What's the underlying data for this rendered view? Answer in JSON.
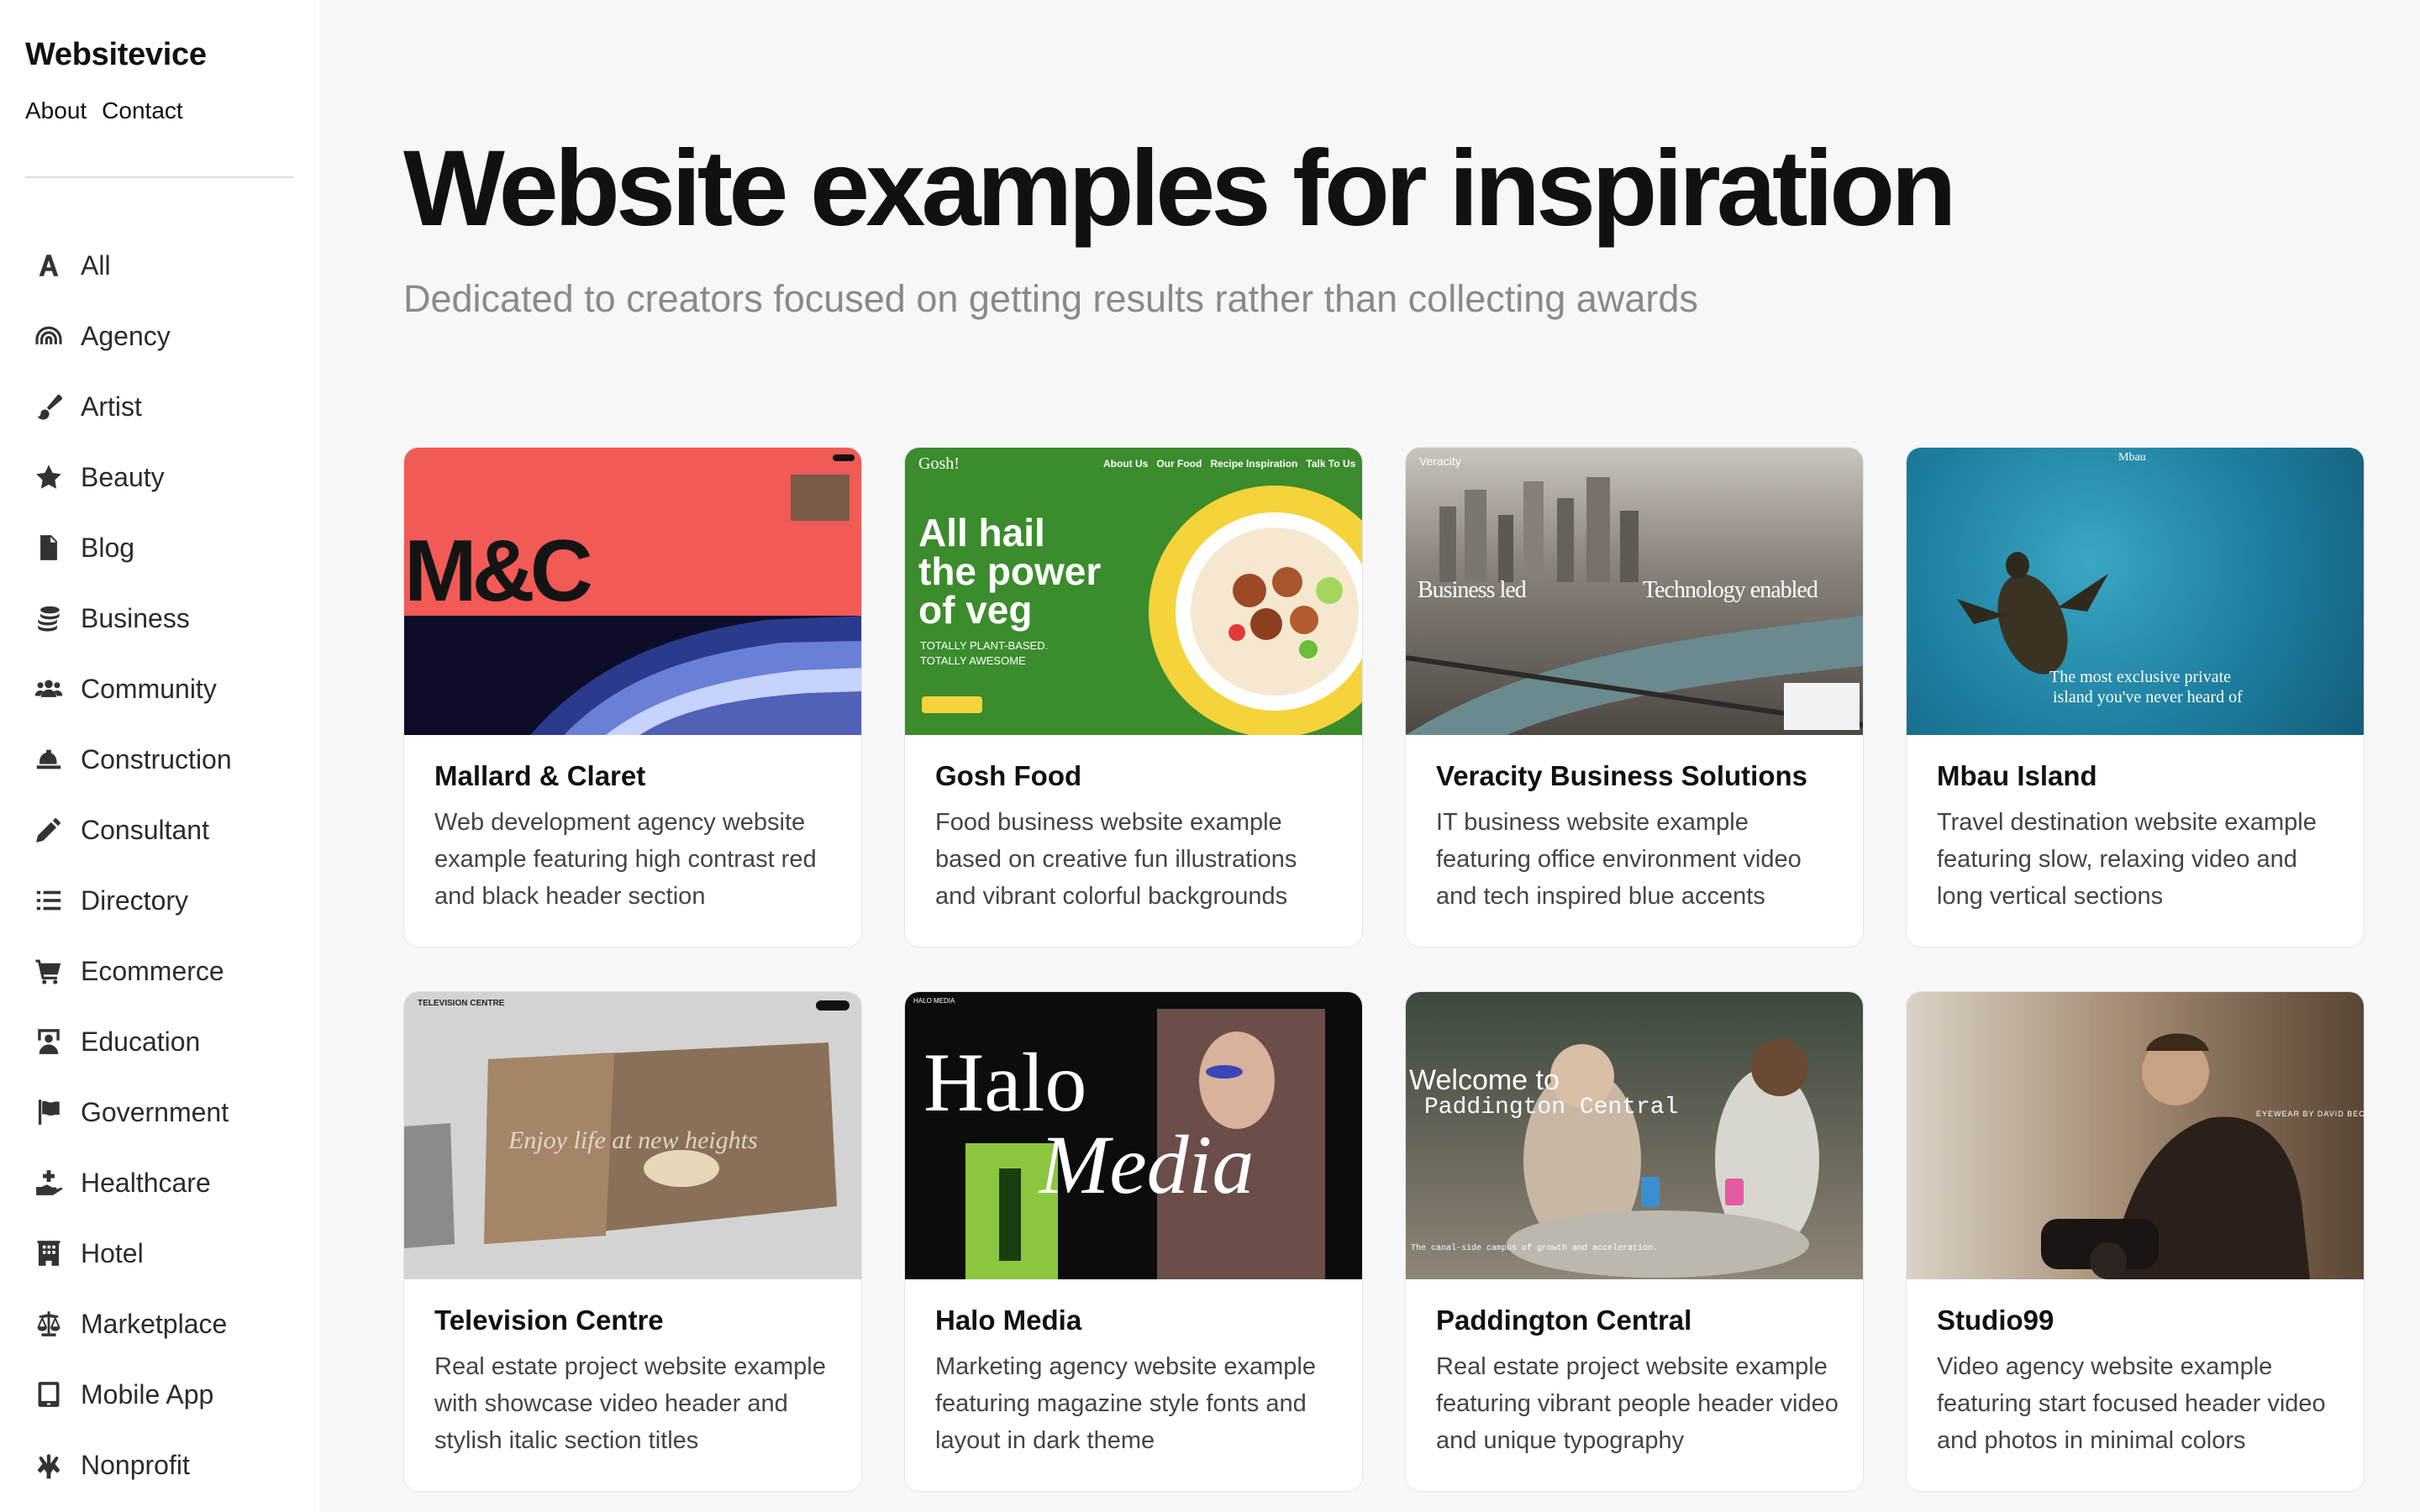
{
  "sidebar": {
    "brand": "Websitevice",
    "nav": [
      "About",
      "Contact"
    ],
    "categories": [
      {
        "label": "All",
        "icon": "letter-a-icon"
      },
      {
        "label": "Agency",
        "icon": "rainbow-icon"
      },
      {
        "label": "Artist",
        "icon": "paintbrush-icon"
      },
      {
        "label": "Beauty",
        "icon": "star-icon"
      },
      {
        "label": "Blog",
        "icon": "document-icon"
      },
      {
        "label": "Business",
        "icon": "coins-icon"
      },
      {
        "label": "Community",
        "icon": "people-icon"
      },
      {
        "label": "Construction",
        "icon": "hard-hat-icon"
      },
      {
        "label": "Consultant",
        "icon": "pencil-icon"
      },
      {
        "label": "Directory",
        "icon": "list-icon"
      },
      {
        "label": "Ecommerce",
        "icon": "cart-icon"
      },
      {
        "label": "Education",
        "icon": "teacher-icon"
      },
      {
        "label": "Government",
        "icon": "flag-icon"
      },
      {
        "label": "Healthcare",
        "icon": "hand-holding-medical-icon"
      },
      {
        "label": "Hotel",
        "icon": "building-icon"
      },
      {
        "label": "Marketplace",
        "icon": "scale-icon"
      },
      {
        "label": "Mobile App",
        "icon": "tablet-icon"
      },
      {
        "label": "Nonprofit",
        "icon": "hands-icon"
      }
    ]
  },
  "hero": {
    "title": "Website examples for inspiration",
    "subtitle": "Dedicated to creators focused on getting results rather than collecting awards"
  },
  "cards": [
    {
      "title": "Mallard & Claret",
      "description": "Web development agency website example featuring high contrast red and black header section",
      "thumb_text": [
        "M&C"
      ],
      "colors": {
        "top": "#f25a56",
        "bottom": "#0d0d2a"
      }
    },
    {
      "title": "Gosh Food",
      "description": "Food business website example based on creative fun illustrations and vibrant colorful backgrounds",
      "thumb_text": [
        "Gosh!",
        "About Us",
        "Our Food",
        "Recipe Inspiration",
        "Talk To Us",
        "All hail",
        "the power",
        "of veg",
        "TOTALLY PLANT-BASED.",
        "TOTALLY AWESOME"
      ],
      "colors": {
        "bg": "#3b8c2c",
        "bowl": "#f5d33a"
      }
    },
    {
      "title": "Veracity Business Solutions",
      "description": "IT business website example featuring office environment video and tech inspired blue accents",
      "thumb_text": [
        "Veracity",
        "Business led",
        "Technology enabled"
      ],
      "colors": {
        "sky": "#c9c4bd",
        "city": "#5c5650"
      }
    },
    {
      "title": "Mbau Island",
      "description": "Travel destination website example featuring slow, relaxing video and long vertical sections",
      "thumb_text": [
        "Mbau",
        "The most exclusive private",
        "island you've never heard of"
      ],
      "colors": {
        "sea": "#1e7ea0"
      }
    },
    {
      "title": "Television Centre",
      "description": "Real estate project website example with showcase video header and stylish italic section titles",
      "thumb_text": [
        "TELEVISION CENTRE",
        "Enjoy life at new heights"
      ],
      "colors": {
        "bg": "#d3d3d3",
        "photo": "#8a7058"
      }
    },
    {
      "title": "Halo Media",
      "description": "Marketing agency website example featuring magazine style fonts and layout in dark theme",
      "thumb_text": [
        "HALO MEDIA",
        "Halo",
        "Media"
      ],
      "colors": {
        "bg": "#0c0c0c",
        "accent": "#8cc63f"
      }
    },
    {
      "title": "Paddington Central",
      "description": "Real estate project website example featuring vibrant people header video and unique typography",
      "thumb_text": [
        "Welcome to",
        "Paddington Central",
        "The canal-side campus of growth and acceleration."
      ],
      "colors": {
        "bg": "#4d5a4a"
      }
    },
    {
      "title": "Studio99",
      "description": "Video agency website example featuring start focused header video and photos in minimal colors",
      "thumb_text": [
        "EYEWEAR BY DAVID BECKHAM"
      ],
      "colors": {
        "bg": "#6f5a45"
      }
    }
  ]
}
